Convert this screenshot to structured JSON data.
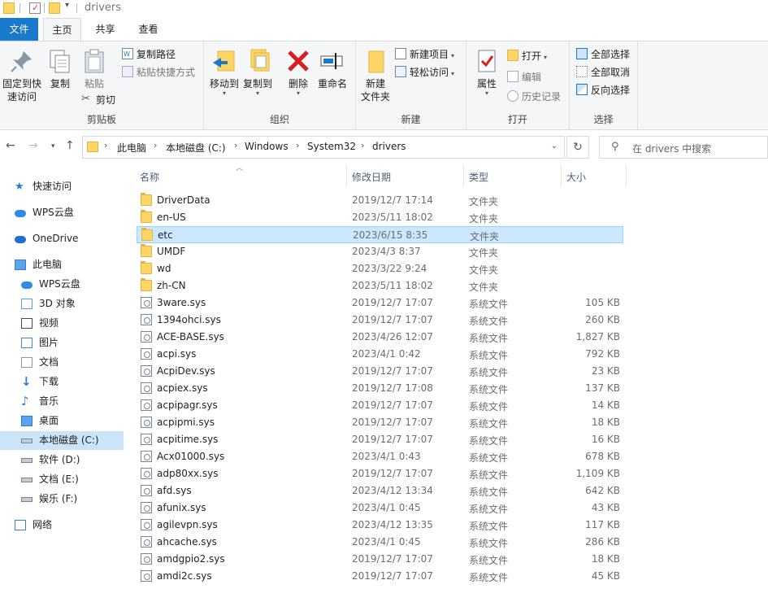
{
  "window": {
    "title": "drivers"
  },
  "ribbon_tabs": [
    "文件",
    "主页",
    "共享",
    "查看"
  ],
  "ribbon": {
    "clipboard": {
      "label": "剪贴板",
      "pin": "固定到快\n速访问",
      "copy": "复制",
      "paste": "粘贴",
      "copy_path": "复制路径",
      "paste_shortcut": "粘贴快捷方式",
      "cut": "剪切"
    },
    "organize": {
      "label": "组织",
      "move_to": "移动到",
      "copy_to": "复制到",
      "delete": "删除",
      "rename": "重命名"
    },
    "new": {
      "label": "新建",
      "new_item": "新建项目",
      "easy_access": "轻松访问",
      "new_folder": "新建\n文件夹"
    },
    "open": {
      "label": "打开",
      "properties": "属性",
      "open": "打开",
      "edit": "编辑",
      "history": "历史记录"
    },
    "select": {
      "label": "选择",
      "select_all": "全部选择",
      "select_none": "全部取消",
      "invert": "反向选择"
    }
  },
  "address": {
    "crumbs": [
      "此电脑",
      "本地磁盘 (C:)",
      "Windows",
      "System32",
      "drivers"
    ],
    "search_placeholder": "在 drivers 中搜索"
  },
  "nav": [
    {
      "label": "快速访问",
      "icon": "star-icon"
    },
    {
      "label": "WPS云盘",
      "icon": "cloud-icon"
    },
    {
      "label": "OneDrive",
      "icon": "onedrive-icon"
    },
    {
      "label": "此电脑",
      "icon": "computer-icon"
    },
    {
      "label": "WPS云盘",
      "icon": "cloud-icon"
    },
    {
      "label": "3D 对象",
      "icon": "cube-icon"
    },
    {
      "label": "视频",
      "icon": "video-icon"
    },
    {
      "label": "图片",
      "icon": "picture-icon"
    },
    {
      "label": "文档",
      "icon": "document-icon"
    },
    {
      "label": "下载",
      "icon": "download-icon"
    },
    {
      "label": "音乐",
      "icon": "music-icon"
    },
    {
      "label": "桌面",
      "icon": "desktop-icon"
    },
    {
      "label": "本地磁盘 (C:)",
      "icon": "drive-icon"
    },
    {
      "label": "软件 (D:)",
      "icon": "drive-icon"
    },
    {
      "label": "文档 (E:)",
      "icon": "drive-icon"
    },
    {
      "label": "娱乐 (F:)",
      "icon": "drive-icon"
    },
    {
      "label": "网络",
      "icon": "network-icon"
    }
  ],
  "columns": [
    "名称",
    "修改日期",
    "类型",
    "大小"
  ],
  "files": [
    {
      "name": "DriverData",
      "date": "2019/12/7 17:14",
      "type": "文件夹",
      "size": "",
      "kind": "folder"
    },
    {
      "name": "en-US",
      "date": "2023/5/11 18:02",
      "type": "文件夹",
      "size": "",
      "kind": "folder"
    },
    {
      "name": "etc",
      "date": "2023/6/15 8:35",
      "type": "文件夹",
      "size": "",
      "kind": "folder"
    },
    {
      "name": "UMDF",
      "date": "2023/4/3 8:37",
      "type": "文件夹",
      "size": "",
      "kind": "folder"
    },
    {
      "name": "wd",
      "date": "2023/3/22 9:24",
      "type": "文件夹",
      "size": "",
      "kind": "folder"
    },
    {
      "name": "zh-CN",
      "date": "2023/5/11 18:02",
      "type": "文件夹",
      "size": "",
      "kind": "folder"
    },
    {
      "name": "3ware.sys",
      "date": "2019/12/7 17:07",
      "type": "系统文件",
      "size": "105 KB",
      "kind": "sys"
    },
    {
      "name": "1394ohci.sys",
      "date": "2019/12/7 17:07",
      "type": "系统文件",
      "size": "260 KB",
      "kind": "sys"
    },
    {
      "name": "ACE-BASE.sys",
      "date": "2023/4/26 12:07",
      "type": "系统文件",
      "size": "1,827 KB",
      "kind": "sys"
    },
    {
      "name": "acpi.sys",
      "date": "2023/4/1 0:42",
      "type": "系统文件",
      "size": "792 KB",
      "kind": "sys"
    },
    {
      "name": "AcpiDev.sys",
      "date": "2019/12/7 17:07",
      "type": "系统文件",
      "size": "23 KB",
      "kind": "sys"
    },
    {
      "name": "acpiex.sys",
      "date": "2019/12/7 17:08",
      "type": "系统文件",
      "size": "137 KB",
      "kind": "sys"
    },
    {
      "name": "acpipagr.sys",
      "date": "2019/12/7 17:07",
      "type": "系统文件",
      "size": "14 KB",
      "kind": "sys"
    },
    {
      "name": "acpipmi.sys",
      "date": "2019/12/7 17:07",
      "type": "系统文件",
      "size": "18 KB",
      "kind": "sys"
    },
    {
      "name": "acpitime.sys",
      "date": "2019/12/7 17:07",
      "type": "系统文件",
      "size": "16 KB",
      "kind": "sys"
    },
    {
      "name": "Acx01000.sys",
      "date": "2023/4/1 0:43",
      "type": "系统文件",
      "size": "678 KB",
      "kind": "sys"
    },
    {
      "name": "adp80xx.sys",
      "date": "2019/12/7 17:07",
      "type": "系统文件",
      "size": "1,109 KB",
      "kind": "sys"
    },
    {
      "name": "afd.sys",
      "date": "2023/4/12 13:34",
      "type": "系统文件",
      "size": "642 KB",
      "kind": "sys"
    },
    {
      "name": "afunix.sys",
      "date": "2023/4/1 0:45",
      "type": "系统文件",
      "size": "43 KB",
      "kind": "sys"
    },
    {
      "name": "agilevpn.sys",
      "date": "2023/4/12 13:35",
      "type": "系统文件",
      "size": "117 KB",
      "kind": "sys"
    },
    {
      "name": "ahcache.sys",
      "date": "2023/4/1 0:45",
      "type": "系统文件",
      "size": "286 KB",
      "kind": "sys"
    },
    {
      "name": "amdgpio2.sys",
      "date": "2019/12/7 17:07",
      "type": "系统文件",
      "size": "18 KB",
      "kind": "sys"
    },
    {
      "name": "amdi2c.sys",
      "date": "2019/12/7 17:07",
      "type": "系统文件",
      "size": "45 KB",
      "kind": "sys"
    }
  ],
  "selected_file": "etc",
  "selected_nav": "本地磁盘 (C:)",
  "colors": {
    "accent": "#1979ca",
    "selection": "#cce8ff",
    "folder": "#ffd566"
  }
}
